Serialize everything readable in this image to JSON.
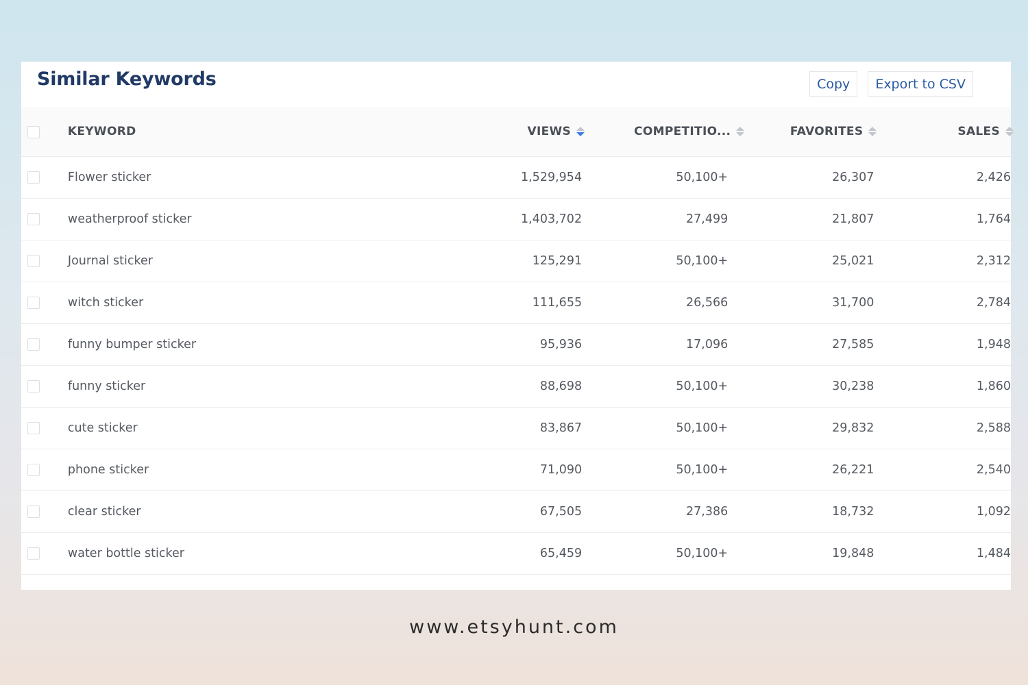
{
  "header": {
    "title": "Similar Keywords",
    "copy_label": "Copy",
    "export_label": "Export to CSV"
  },
  "columns": {
    "keyword": "KEYWORD",
    "views": "VIEWS",
    "competition": "COMPETITIO...",
    "favorites": "FAVORITES",
    "sales": "SALES"
  },
  "rows": [
    {
      "keyword": "Flower sticker",
      "views": "1,529,954",
      "competition": "50,100+",
      "favorites": "26,307",
      "sales": "2,426"
    },
    {
      "keyword": "weatherproof sticker",
      "views": "1,403,702",
      "competition": "27,499",
      "favorites": "21,807",
      "sales": "1,764"
    },
    {
      "keyword": "Journal sticker",
      "views": "125,291",
      "competition": "50,100+",
      "favorites": "25,021",
      "sales": "2,312"
    },
    {
      "keyword": "witch sticker",
      "views": "111,655",
      "competition": "26,566",
      "favorites": "31,700",
      "sales": "2,784"
    },
    {
      "keyword": "funny bumper sticker",
      "views": "95,936",
      "competition": "17,096",
      "favorites": "27,585",
      "sales": "1,948"
    },
    {
      "keyword": "funny sticker",
      "views": "88,698",
      "competition": "50,100+",
      "favorites": "30,238",
      "sales": "1,860"
    },
    {
      "keyword": "cute sticker",
      "views": "83,867",
      "competition": "50,100+",
      "favorites": "29,832",
      "sales": "2,588"
    },
    {
      "keyword": "phone sticker",
      "views": "71,090",
      "competition": "50,100+",
      "favorites": "26,221",
      "sales": "2,540"
    },
    {
      "keyword": "clear sticker",
      "views": "67,505",
      "competition": "27,386",
      "favorites": "18,732",
      "sales": "1,092"
    },
    {
      "keyword": "water bottle sticker",
      "views": "65,459",
      "competition": "50,100+",
      "favorites": "19,848",
      "sales": "1,484"
    }
  ],
  "sort": {
    "active_column": "views",
    "direction": "descending"
  },
  "colors": {
    "title": "#213a66",
    "button_text": "#2a5aa0",
    "sort_active": "#3b7ddd"
  },
  "footer": {
    "watermark": "www.etsyhunt.com"
  }
}
